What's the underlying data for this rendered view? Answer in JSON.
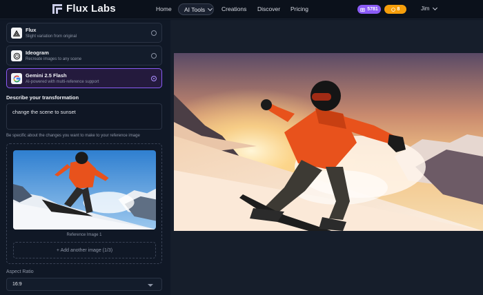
{
  "app": {
    "name": "Flux Labs"
  },
  "nav": {
    "home": "Home",
    "ai_tools": "AI Tools",
    "creations": "Creations",
    "discover": "Discover",
    "pricing": "Pricing",
    "credits": "5781",
    "points": "8",
    "user": "Jim"
  },
  "models": [
    {
      "name": "Flux",
      "desc": "Slight variation from original",
      "selected": false,
      "icon": "triangle-icon"
    },
    {
      "name": "Ideogram",
      "desc": "Recreate images to any scene",
      "selected": false,
      "icon": "ideogram-icon"
    },
    {
      "name": "Gemini 2.5 Flash",
      "desc": "AI-powered with multi-reference support",
      "selected": true,
      "icon": "google-g-icon"
    }
  ],
  "transform": {
    "label": "Describe your transformation",
    "value": "change the scene to sunset",
    "hint": "Be specific about the changes you want to make to your reference image"
  },
  "reference": {
    "caption": "Reference Image 1",
    "add_label": "+ Add another image (1/3)"
  },
  "aspect": {
    "label": "Aspect Ratio",
    "value": "16:9"
  },
  "colors": {
    "accent": "#8b5cf6",
    "points": "#f59e0b",
    "jacket": "#e8521c"
  }
}
